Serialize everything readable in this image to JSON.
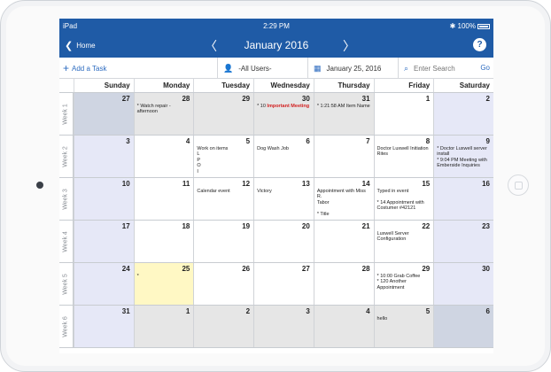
{
  "status": {
    "carrier": "iPad",
    "time": "2:29 PM",
    "battery": "100%"
  },
  "nav": {
    "back_label": "Home",
    "title": "January 2016"
  },
  "toolbar": {
    "add_task": "Add a Task",
    "users": "-All Users-",
    "date": "January 25, 2016",
    "search_placeholder": "Enter Search",
    "go": "Go"
  },
  "weekdays": [
    "Sunday",
    "Monday",
    "Tuesday",
    "Wednesday",
    "Thursday",
    "Friday",
    "Saturday"
  ],
  "weeks": [
    {
      "label": "Week 1",
      "days": [
        {
          "n": "27",
          "style": "weekend-other"
        },
        {
          "n": "28",
          "style": "other",
          "ev": "*  Watch repair - afternoon"
        },
        {
          "n": "29",
          "style": "other"
        },
        {
          "n": "30",
          "style": "other",
          "ev": "* 10 ",
          "ev_red": "Important Meeting"
        },
        {
          "n": "31",
          "style": "other",
          "ev": "* 1:21:58 AM Item Name"
        },
        {
          "n": "1",
          "style": ""
        },
        {
          "n": "2",
          "style": "wkend"
        }
      ]
    },
    {
      "label": "Week 2",
      "days": [
        {
          "n": "3",
          "style": "wkend"
        },
        {
          "n": "4",
          "style": ""
        },
        {
          "n": "5",
          "style": "",
          "ev": "Work on items\nL\nP\nO\nI"
        },
        {
          "n": "6",
          "style": "",
          "ev": "Dog Wash Job"
        },
        {
          "n": "7",
          "style": ""
        },
        {
          "n": "8",
          "style": "",
          "ev": "Doctor Luxwell Initiation\nRites"
        },
        {
          "n": "9",
          "style": "wkend",
          "ev": "*  Doctor Luxwell server\ninstall\n* 9:04 PM Meeting with\nEmberside Inquiries"
        }
      ]
    },
    {
      "label": "Week 3",
      "days": [
        {
          "n": "10",
          "style": "wkend"
        },
        {
          "n": "11",
          "style": ""
        },
        {
          "n": "12",
          "style": "",
          "ev": "Calendar event"
        },
        {
          "n": "13",
          "style": "",
          "ev": "Victory"
        },
        {
          "n": "14",
          "style": "",
          "ev": "Appointment with Miss R.\nTabor\n\n*  Title"
        },
        {
          "n": "15",
          "style": "",
          "ev": "Typed in event\n\n* 14 Appointment with\nCostumer #42121"
        },
        {
          "n": "16",
          "style": "wkend"
        }
      ]
    },
    {
      "label": "Week 4",
      "days": [
        {
          "n": "17",
          "style": "wkend"
        },
        {
          "n": "18",
          "style": ""
        },
        {
          "n": "19",
          "style": ""
        },
        {
          "n": "20",
          "style": ""
        },
        {
          "n": "21",
          "style": ""
        },
        {
          "n": "22",
          "style": "",
          "ev": "Luxwell Server\nConfiguration"
        },
        {
          "n": "23",
          "style": "wkend"
        }
      ]
    },
    {
      "label": "Week 5",
      "days": [
        {
          "n": "24",
          "style": "wkend"
        },
        {
          "n": "25",
          "style": "today",
          "ev": "*"
        },
        {
          "n": "26",
          "style": ""
        },
        {
          "n": "27",
          "style": ""
        },
        {
          "n": "28",
          "style": ""
        },
        {
          "n": "29",
          "style": "",
          "ev": "* 10:00 Grab Coffee\n* 120 Another Appointment"
        },
        {
          "n": "30",
          "style": "wkend"
        }
      ]
    },
    {
      "label": "Week 6",
      "days": [
        {
          "n": "31",
          "style": "wkend"
        },
        {
          "n": "1",
          "style": "other"
        },
        {
          "n": "2",
          "style": "other"
        },
        {
          "n": "3",
          "style": "other"
        },
        {
          "n": "4",
          "style": "other"
        },
        {
          "n": "5",
          "style": "other",
          "ev": "hello"
        },
        {
          "n": "6",
          "style": "weekend-other"
        }
      ]
    }
  ],
  "colors": {
    "brand": "#1f5ba6",
    "today": "#fff8c4",
    "weekend": "#e6e8f7",
    "other_month": "#e6e6e6",
    "important": "#d21f1f"
  }
}
